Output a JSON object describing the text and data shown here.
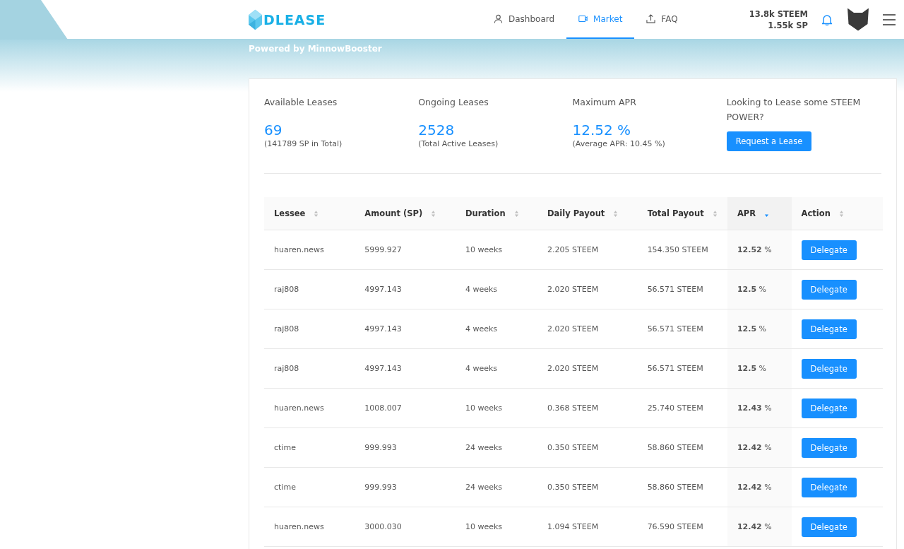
{
  "header": {
    "logo": "DLEASE",
    "tagline": "Powered by MinnowBooster",
    "nav": [
      {
        "label": "Dashboard",
        "selected": false
      },
      {
        "label": "Market",
        "selected": true
      },
      {
        "label": "FAQ",
        "selected": false
      }
    ],
    "balance": [
      "13.8k STEEM",
      "1.55k SP"
    ]
  },
  "stats": [
    {
      "title": "Available Leases",
      "value": "69",
      "note": "(141789 SP in Total)"
    },
    {
      "title": "Ongoing Leases",
      "value": "2528",
      "note": "(Total Active Leases)"
    },
    {
      "title": "Maximum APR",
      "value": "12.52 %",
      "note": "(Average APR: 10.45 %)"
    }
  ],
  "request": {
    "text": "Looking to Lease some STEEM POWER?",
    "button": "Request a Lease"
  },
  "table": {
    "columns": [
      {
        "label": "Lessee",
        "selected": false
      },
      {
        "label": "Amount (SP)",
        "selected": false
      },
      {
        "label": "Duration",
        "selected": false
      },
      {
        "label": "Daily Payout",
        "selected": false
      },
      {
        "label": "Total Payout",
        "selected": false
      },
      {
        "label": "APR",
        "selected": true
      },
      {
        "label": "Action",
        "selected": false
      }
    ],
    "rows": [
      [
        "huaren.news",
        "5999.927",
        "10 weeks",
        "2.205 STEEM",
        "154.350 STEEM",
        "**12.52** %",
        "Delegate"
      ],
      [
        "raj808",
        "4997.143",
        "4 weeks",
        "2.020 STEEM",
        "56.571 STEEM",
        "**12.5** %",
        "Delegate"
      ],
      [
        "raj808",
        "4997.143",
        "4 weeks",
        "2.020 STEEM",
        "56.571 STEEM",
        "**12.5** %",
        "Delegate"
      ],
      [
        "raj808",
        "4997.143",
        "4 weeks",
        "2.020 STEEM",
        "56.571 STEEM",
        "**12.5** %",
        "Delegate"
      ],
      [
        "huaren.news",
        "1008.007",
        "10 weeks",
        "0.368 STEEM",
        "25.740 STEEM",
        "**12.43** %",
        "Delegate"
      ],
      [
        "ctime",
        "999.993",
        "24 weeks",
        "0.350 STEEM",
        "58.860 STEEM",
        "**12.42** %",
        "Delegate"
      ],
      [
        "ctime",
        "999.993",
        "24 weeks",
        "0.350 STEEM",
        "58.860 STEEM",
        "**12.42** %",
        "Delegate"
      ],
      [
        "huaren.news",
        "3000.030",
        "10 weeks",
        "1.094 STEEM",
        "76.590 STEEM",
        "**12.42** %",
        "Delegate"
      ]
    ]
  }
}
